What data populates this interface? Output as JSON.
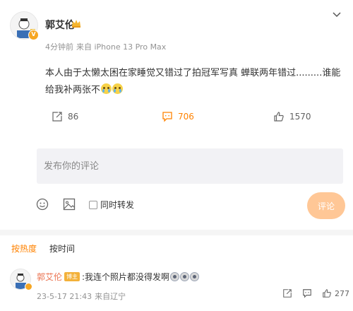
{
  "post": {
    "author": "郭艾伦",
    "time": "4分钟前",
    "source": "来自 iPhone 13 Pro Max",
    "content": "本人由于太懒太困在家睡觉又错过了拍冠军写真  蝉联两年错过.........谁能给我补两张不",
    "content_emojis": [
      "crying-emoji",
      "crying-emoji"
    ],
    "repost_count": "86",
    "comment_count": "706",
    "like_count": "1570"
  },
  "composer": {
    "placeholder": "发布你的评论",
    "repost_label": "同时转发",
    "submit_label": "评论"
  },
  "sort": {
    "hot": "按热度",
    "time": "按时间"
  },
  "comment": {
    "author": "郭艾伦",
    "badge": "博主",
    "text": ":我连个照片都没得发啊",
    "emojis": [
      "shocked-emoji",
      "shocked-emoji",
      "shocked-emoji"
    ],
    "time": "23-5-17 21:43",
    "source": "来自辽宁",
    "like_count": "277"
  },
  "colors": {
    "accent": "#ff8200",
    "submit_bg": "#ffc796",
    "author_link": "#eb7350"
  }
}
